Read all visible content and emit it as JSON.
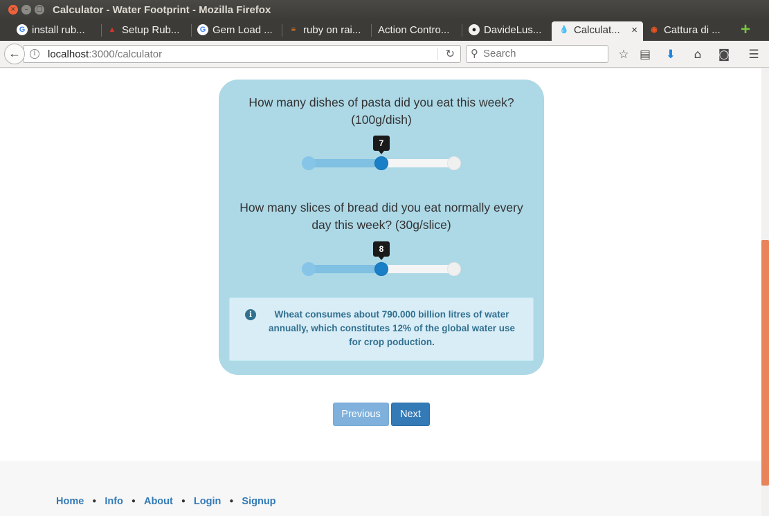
{
  "window": {
    "title": "Calculator - Water Footprint - Mozilla Firefox"
  },
  "tabs": [
    {
      "label": "install rub...",
      "icon": "google-icon"
    },
    {
      "label": "Setup Rub...",
      "icon": "rails-icon"
    },
    {
      "label": "Gem Load ...",
      "icon": "google-icon"
    },
    {
      "label": "ruby on rai...",
      "icon": "stackoverflow-icon"
    },
    {
      "label": "Action Contro...",
      "icon": ""
    },
    {
      "label": "DavideLus...",
      "icon": "github-icon"
    },
    {
      "label": "Calculat...",
      "icon": "water-drop-icon",
      "active": true
    },
    {
      "label": "Cattura di ...",
      "icon": "ubuntu-icon"
    }
  ],
  "navbar": {
    "url_host": "localhost",
    "url_rest": ":3000/calculator",
    "search_placeholder": "Search"
  },
  "questions": [
    {
      "text": "How many dishes of pasta did you eat this week? (100g/dish)",
      "value": "7",
      "level": 0.5
    },
    {
      "text": "How many slices of bread did you eat normally every day this week? (30g/slice)",
      "value": "8",
      "level": 0.5
    }
  ],
  "info": {
    "text": "Wheat consumes about 790.000 billion litres of water annually, which constitutes 12% of the global water use for crop poduction."
  },
  "buttons": {
    "previous": "Previous",
    "next": "Next"
  },
  "footer": {
    "links": [
      "Home",
      "Info",
      "About",
      "Login",
      "Signup"
    ]
  },
  "colors": {
    "card": "#add8e6",
    "primary": "#337ab7",
    "slider_handle": "#1a7fc6",
    "alert_text": "#31708f"
  }
}
